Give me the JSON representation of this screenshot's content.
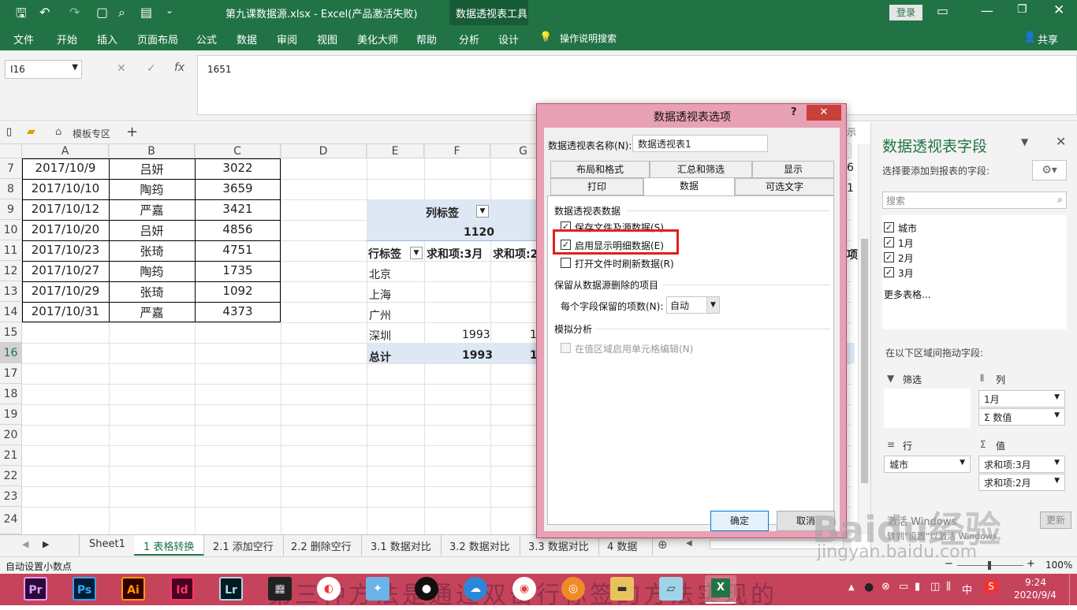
{
  "title_bar": {
    "file_title": "第九课数据源.xlsx - Excel(产品激活失败)",
    "context_tools": "数据透视表工具",
    "login": "登录"
  },
  "ribbon_tabs": [
    "文件",
    "开始",
    "插入",
    "页面布局",
    "公式",
    "数据",
    "审阅",
    "视图",
    "美化大师",
    "帮助",
    "分析",
    "设计"
  ],
  "tell_me": "操作说明搜索",
  "share": "共享",
  "name_box": "I16",
  "formula_value": "1651",
  "template_tab": "模板专区",
  "columns": [
    "A",
    "B",
    "C",
    "D",
    "E",
    "F",
    "G"
  ],
  "rows": [
    "7",
    "8",
    "9",
    "10",
    "11",
    "12",
    "13",
    "14",
    "15",
    "16",
    "17",
    "18",
    "19",
    "20",
    "21",
    "22",
    "23",
    "24"
  ],
  "data_rows": [
    {
      "date": "2017/10/9",
      "name": "吕妍",
      "value": "3022"
    },
    {
      "date": "2017/10/10",
      "name": "陶筠",
      "value": "3659"
    },
    {
      "date": "2017/10/12",
      "name": "严嘉",
      "value": "3421"
    },
    {
      "date": "2017/10/20",
      "name": "吕妍",
      "value": "4856"
    },
    {
      "date": "2017/10/23",
      "name": "张琦",
      "value": "4751"
    },
    {
      "date": "2017/10/27",
      "name": "陶筠",
      "value": "1735"
    },
    {
      "date": "2017/10/29",
      "name": "张琦",
      "value": "1092"
    },
    {
      "date": "2017/10/31",
      "name": "严嘉",
      "value": "4373"
    }
  ],
  "pivot": {
    "col_label": "列标签",
    "col_value": "1120",
    "row_label": "行标签",
    "sum_mar": "求和项:3月",
    "sum_feb": "求和项:2",
    "cities": [
      "北京",
      "上海",
      "广州",
      "深圳"
    ],
    "shenzhen_value": "1993",
    "shenzhen_partial": "1",
    "total_label": "总计",
    "total_value": "1993",
    "total_partial": "1",
    "right_hint": "示",
    "right_6": "6",
    "right_1": "1",
    "right_item": "项"
  },
  "dialog": {
    "title": "数据透视表选项",
    "help": "?",
    "name_label": "数据透视表名称(N):",
    "name_value": "数据透视表1",
    "tabs_row1": [
      "布局和格式",
      "汇总和筛选",
      "显示"
    ],
    "tabs_row2": [
      "打印",
      "数据",
      "可选文字"
    ],
    "section1": "数据透视表数据",
    "opt_save": "保存文件及源数据(S)",
    "opt_enable": "启用显示明细数据(E)",
    "opt_refresh": "打开文件时刷新数据(R)",
    "section2": "保留从数据源删除的项目",
    "items_label": "每个字段保留的项数(N):",
    "items_value": "自动",
    "section3": "模拟分析",
    "opt_whatif": "在值区域启用单元格编辑(N)",
    "ok": "确定",
    "cancel": "取消"
  },
  "pane": {
    "title": "数据透视表字段",
    "subtitle": "选择要添加到报表的字段:",
    "search_placeholder": "搜索",
    "fields": [
      "城市",
      "1月",
      "2月",
      "3月"
    ],
    "more_tables": "更多表格...",
    "drag_hint": "在以下区域间拖动字段:",
    "filter": "筛选",
    "columns": "列",
    "rows": "行",
    "values": "值",
    "col_items": [
      "1月",
      "Σ 数值"
    ],
    "row_items": [
      "城市"
    ],
    "value_items": [
      "求和项:3月",
      "求和项:2月"
    ],
    "update": "更新",
    "activate_line1": "激活 Windows",
    "activate_line2": "转到\"设置\"以激活 Windows。"
  },
  "sheet_tabs": [
    "Sheet1",
    "1 表格转换",
    "2.1 添加空行",
    "2.2 删除空行",
    "3.1 数据对比",
    "3.2 数据对比",
    "3.3 数据对比",
    "4 数据"
  ],
  "status": {
    "mode": "自动设置小数点",
    "zoom": "100%"
  },
  "clock": {
    "time": "9:24",
    "date": "2020/9/4"
  },
  "taskbar_apps": [
    "Pr",
    "Ps",
    "Ai",
    "Id",
    "Lr"
  ],
  "overlay_text": "第三种方法是通过双击行标签的方法实现的",
  "watermark": "Baidu经验",
  "watermark_url": "jingyan.baidu.com",
  "tray_lang": "中"
}
